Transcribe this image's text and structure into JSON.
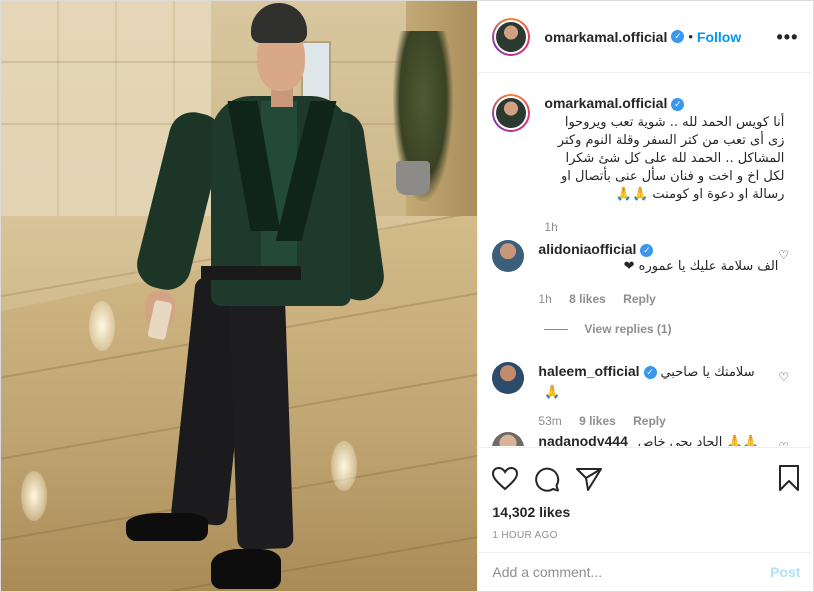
{
  "header": {
    "username": "omarkamal.official",
    "dot": "•",
    "follow_label": "Follow",
    "more_label": "•••"
  },
  "caption": {
    "username": "omarkamal.official",
    "text": "أنا كويس الحمد لله .. شوية تعب ويروحوا زى أى تعب من كتر السفر وقلة النوم وكتر المشاكل .. الحمد لله على كل شئ شكرا لكل اخ و اخت و فنان سأل عنى بأتصال او رسالة او دعوة او كومنت 🙏🙏",
    "age": "1h"
  },
  "comments": [
    {
      "username": "alidoniaofficial",
      "text": "الف سلامة عليك يا عموره ❤",
      "age": "1h",
      "likes": "8 likes",
      "reply_label": "Reply"
    },
    {
      "username": "haleem_official",
      "text": "سلامتك يا صاحبي 🙏",
      "age": "53m",
      "likes": "9 likes",
      "reply_label": "Reply"
    },
    {
      "username": "nadanody444",
      "text": "الجاد يجي خاص 🙏🙏"
    }
  ],
  "view_replies_label": "View replies (1)",
  "likes_count": "14,302 likes",
  "timestamp": "1 HOUR AGO",
  "add_comment": {
    "placeholder": "Add a comment...",
    "post_label": "Post"
  },
  "colors": {
    "link_blue": "#0095f6",
    "verified_blue": "#3897f0",
    "muted": "#8e8e8e"
  }
}
